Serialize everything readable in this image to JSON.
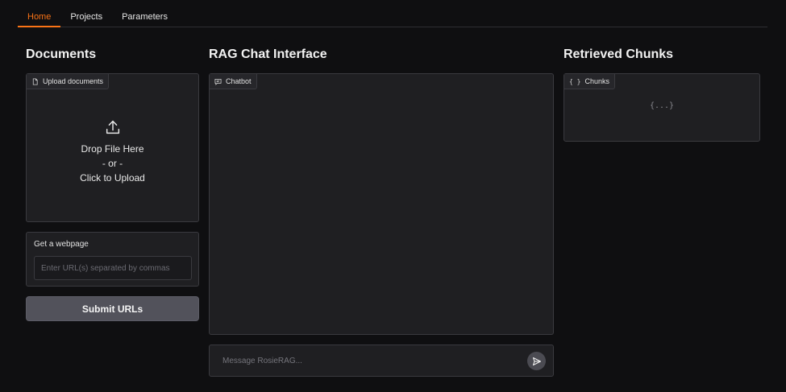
{
  "tabs": [
    {
      "label": "Home",
      "active": true
    },
    {
      "label": "Projects",
      "active": false
    },
    {
      "label": "Parameters",
      "active": false
    }
  ],
  "documents": {
    "heading": "Documents",
    "upload_label": "Upload documents",
    "upload_icon": "upload-icon",
    "drop_text": "Drop File Here",
    "or_text": "- or -",
    "click_text": "Click to Upload",
    "webpage_label": "Get a webpage",
    "url_placeholder": "Enter URL(s) separated by commas",
    "url_value": "",
    "submit_label": "Submit URLs"
  },
  "chat": {
    "heading": "RAG Chat Interface",
    "chatbot_label": "Chatbot",
    "message_placeholder": "Message RosieRAG...",
    "message_value": ""
  },
  "chunks": {
    "heading": "Retrieved Chunks",
    "label": "Chunks",
    "empty_placeholder": "{...}"
  },
  "colors": {
    "accent": "#f97316",
    "background": "#0f0f11",
    "panel": "#1f1f22",
    "button": "#52525b"
  }
}
